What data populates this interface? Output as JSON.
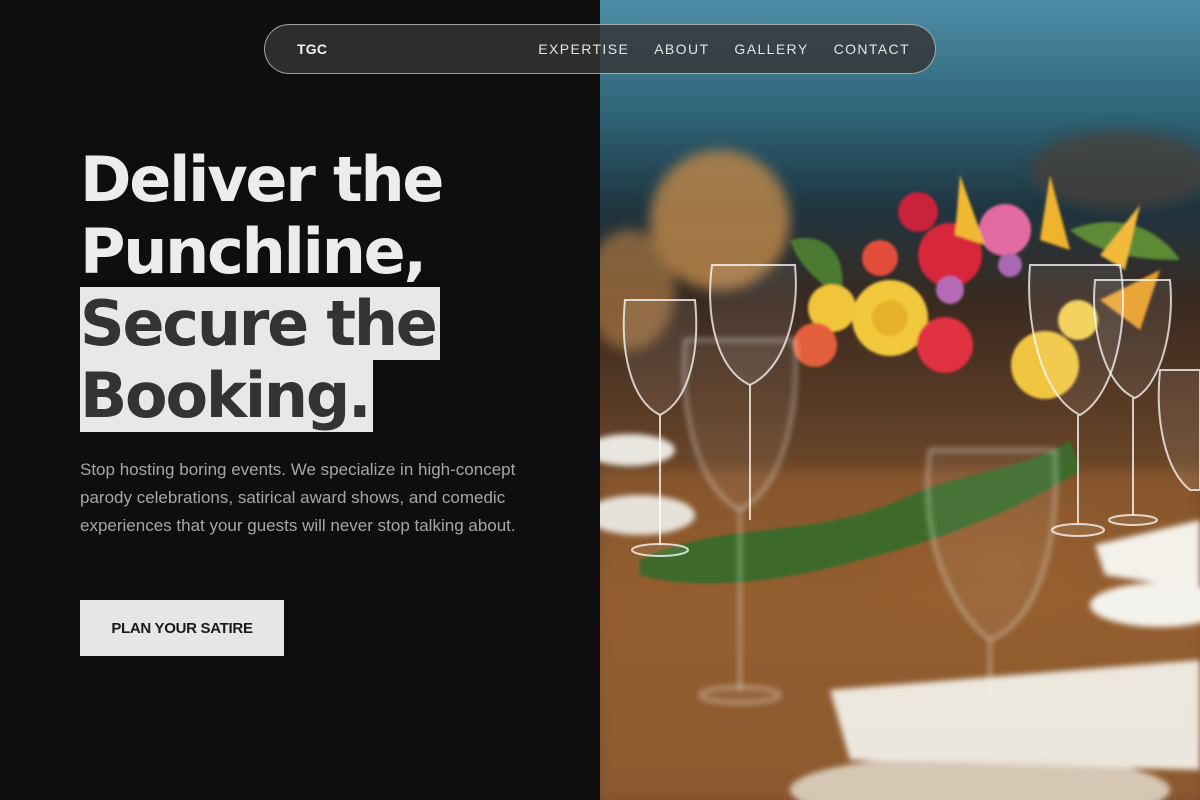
{
  "nav": {
    "logo": "TGC",
    "links": [
      "EXPERTISE",
      "ABOUT",
      "GALLERY",
      "CONTACT"
    ]
  },
  "hero": {
    "headline_lines": [
      "Deliver the",
      "Punchline,",
      "Secure the",
      "Booking."
    ],
    "subtitle": "Stop hosting boring events. We specialize in high-concept parody celebrations, satirical award shows, and comedic experiences that your guests will never stop talking about.",
    "cta_label": "PLAN YOUR SATIRE"
  },
  "image": {
    "alt": "Banquet table with floral centerpiece and wine glasses"
  },
  "colors": {
    "background": "#0e0e0e",
    "headline": "#ececec",
    "highlight_bg": "#e8e8e8",
    "highlight_text": "#333333",
    "cta_bg": "#e6e6e6"
  }
}
